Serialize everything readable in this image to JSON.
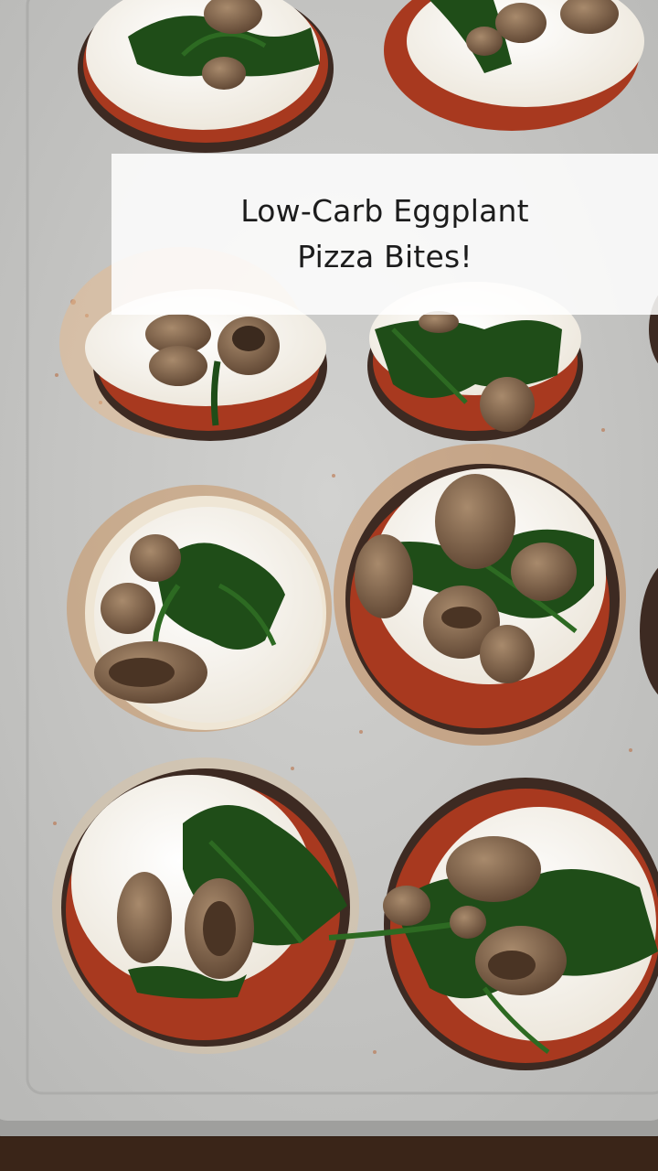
{
  "title": {
    "line1": "Low-Carb Eggplant",
    "line2": "Pizza Bites!"
  },
  "colors": {
    "table": "#3a2518",
    "tray": "#c8c8c6",
    "tray_rim": "#a9a9a7",
    "eggplant": "#3d2a22",
    "sauce": "#a8391f",
    "cheese": "#f8f6f0",
    "spinach": "#1f4d18",
    "mushroom": "#8a6a4e",
    "banner": "#ffffff"
  },
  "photo": {
    "pizza_bite_count": 9
  }
}
